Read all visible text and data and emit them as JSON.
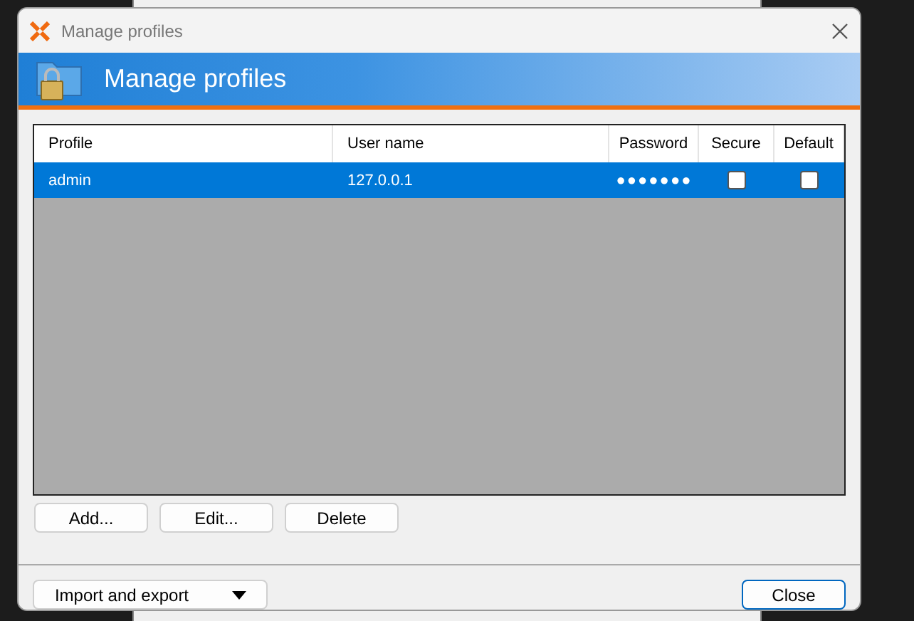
{
  "window": {
    "title": "Manage profiles"
  },
  "banner": {
    "title": "Manage profiles"
  },
  "table": {
    "columns": [
      "Profile",
      "User name",
      "Password",
      "Secure",
      "Default"
    ],
    "rows": [
      {
        "profile": "admin",
        "user_name": "127.0.0.1",
        "password": "●●●●●●●",
        "secure": false,
        "default": false,
        "selected": true
      }
    ]
  },
  "list_buttons": [
    "Add...",
    "Edit...",
    "Delete"
  ],
  "import_export": {
    "label": "Import and export"
  },
  "close_button": "Close"
}
